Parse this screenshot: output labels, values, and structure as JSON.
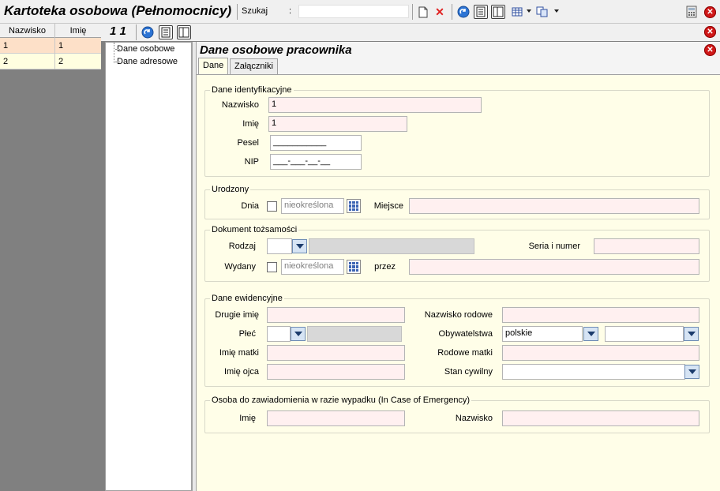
{
  "app": {
    "title": "Kartoteka osobowa (Pełnomocnicy)",
    "search_label": "Szukaj",
    "search_colon": ":",
    "search_value": ""
  },
  "toolbar_icons": [
    "new-document-icon",
    "delete-icon",
    "refresh-icon",
    "form-view-icon",
    "split-view-icon",
    "grid-view-icon",
    "copy-icon",
    "calculator-icon",
    "close-icon"
  ],
  "grid": {
    "columns": [
      "Nazwisko",
      "Imię"
    ],
    "rows": [
      [
        "1",
        "1"
      ],
      [
        "2",
        "2"
      ]
    ]
  },
  "secondary": {
    "record_label": "1 1"
  },
  "tree": {
    "items": [
      "Dane osobowe",
      "Dane adresowe"
    ]
  },
  "panel": {
    "title": "Dane osobowe pracownika",
    "tabs": [
      {
        "label": "Dane"
      },
      {
        "label": "Załączniki"
      }
    ]
  },
  "sections": {
    "identification": {
      "title": "Dane identyfikacyjne",
      "nazwisko_label": "Nazwisko",
      "nazwisko_value": "1",
      "imie_label": "Imię",
      "imie_value": "1",
      "pesel_label": "Pesel",
      "pesel_value": "___________",
      "nip_label": "NIP",
      "nip_value": "___-___-__-__"
    },
    "birth": {
      "title": "Urodzony",
      "dnia_label": "Dnia",
      "date_placeholder": "nieokreślona",
      "miejsce_label": "Miejsce"
    },
    "document": {
      "title": "Dokument tożsamości",
      "rodzaj_label": "Rodzaj",
      "seria_label": "Seria i numer",
      "wydany_label": "Wydany",
      "date_placeholder": "nieokreślona",
      "przez_label": "przez"
    },
    "records": {
      "title": "Dane ewidencyjne",
      "drugie_imie_label": "Drugie imię",
      "nazwisko_rodowe_label": "Nazwisko rodowe",
      "plec_label": "Płeć",
      "obywatelstwa_label": "Obywatelstwa",
      "obywatelstwa_value": "polskie",
      "imie_matki_label": "Imię matki",
      "rodowe_matki_label": "Rodowe matki",
      "imie_ojca_label": "Imię ojca",
      "stan_cywilny_label": "Stan cywilny"
    },
    "emergency": {
      "title": "Osoba do zawiadomienia w razie wypadku (In Case of Emergency)",
      "imie_label": "Imię",
      "nazwisko_label": "Nazwisko"
    }
  },
  "colors": {
    "selected_row": "#fde0c8",
    "form_background": "#fffee8",
    "required_field": "#fff0f0"
  }
}
